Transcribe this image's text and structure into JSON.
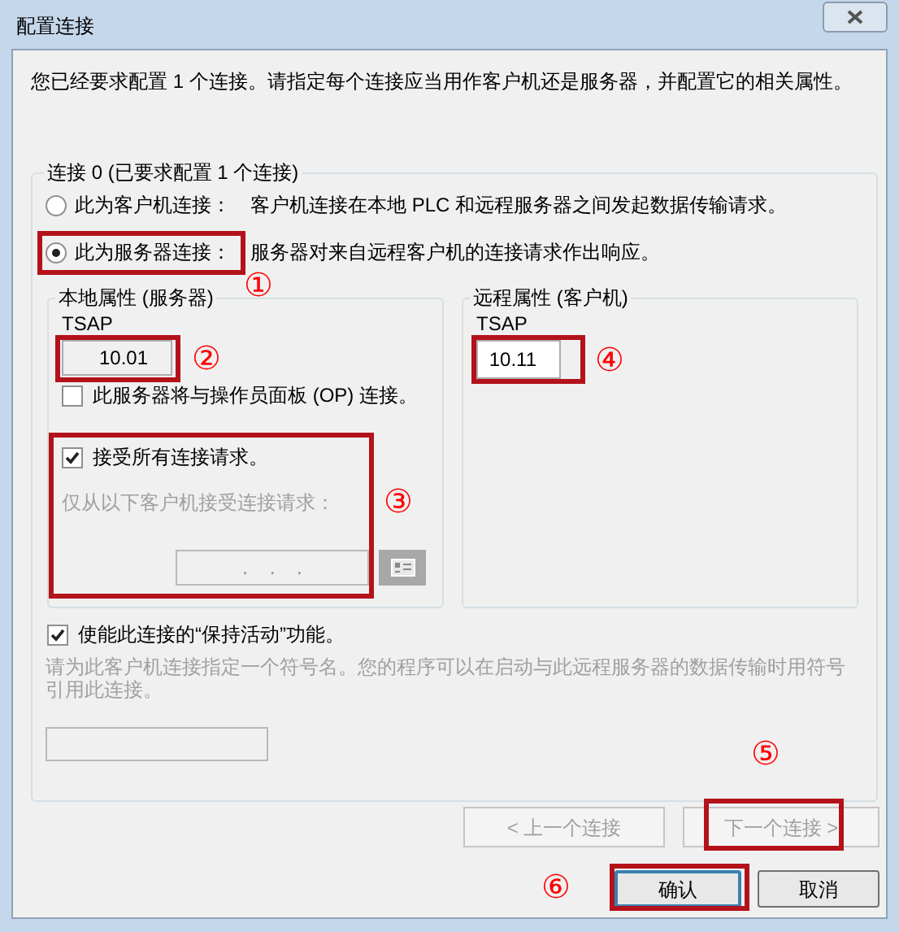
{
  "window": {
    "title": "配置连接"
  },
  "intro": "您已经要求配置 1 个连接。请指定每个连接应当用作客户机还是服务器，并配置它的相关属性。",
  "connection": {
    "title": "连接 0 (已要求配置 1 个连接)",
    "role_options": [
      {
        "label": "此为客户机连接：",
        "description": "客户机连接在本地 PLC 和远程服务器之间发起数据传输请求。",
        "selected": false
      },
      {
        "label": "此为服务器连接：",
        "description": "服务器对来自远程客户机的连接请求作出响应。",
        "selected": true
      }
    ],
    "local": {
      "title": "本地属性 (服务器)",
      "tsap_label": "TSAP",
      "tsap": "10.01",
      "read_only": true,
      "op_checkbox": {
        "label": "此服务器将与操作员面板 (OP) 连接。",
        "checked": false
      },
      "accept_all": {
        "label": "接受所有连接请求。",
        "checked": true
      },
      "client_filter": {
        "label": "仅从以下客户机接受连接请求：",
        "ip": ".    .    .",
        "disabled": true
      }
    },
    "remote": {
      "title": "远程属性 (客户机)",
      "tsap_label": "TSAP",
      "tsap": "10.11",
      "read_only": false
    },
    "keep_alive": {
      "label": "使能此连接的“保持活动”功能。",
      "checked": true
    },
    "symbol": {
      "hint": "请为此客户机连接指定一个符号名。您的程序可以在启动与此远程服务器的数据传输时用符号引用此连接。",
      "disabled": true
    }
  },
  "nav_buttons": [
    {
      "label": "< 上一个连接",
      "disabled": true
    },
    {
      "label": "下一个连接 >",
      "disabled": true
    }
  ],
  "buttons": [
    {
      "label": "确认",
      "default": true
    },
    {
      "label": "取消",
      "default": false
    }
  ],
  "annotations": [
    {
      "marker": "①"
    },
    {
      "marker": "②"
    },
    {
      "marker": "③"
    },
    {
      "marker": "④"
    },
    {
      "marker": "⑤"
    },
    {
      "marker": "⑥"
    }
  ]
}
